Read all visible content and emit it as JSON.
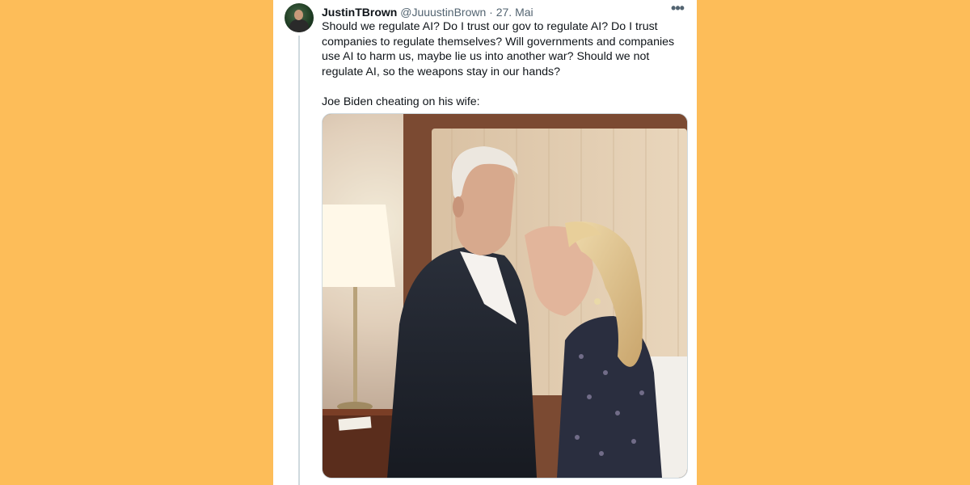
{
  "tweet": {
    "display_name": "JustinTBrown",
    "handle": "@JuuustinBrown",
    "separator": "·",
    "date": "27. Mai",
    "more_icon": "more-horizontal-icon",
    "text_paragraph_1": "Should we regulate AI? Do I trust our gov to regulate AI? Do I trust companies to regulate themselves? Will governments and companies use AI to harm us, maybe lie us into another war? Should we not regulate AI, so the weapons stay in our hands?",
    "text_paragraph_2": "Joe Biden cheating on his wife:"
  },
  "colors": {
    "background": "#FDBD59",
    "card": "#ffffff",
    "text": "#0f1419",
    "muted": "#536471",
    "thread_line": "#cfd9de"
  }
}
